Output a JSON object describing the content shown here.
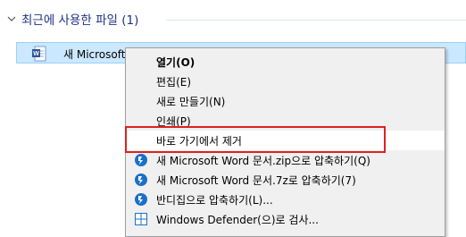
{
  "group": {
    "title": "최근에 사용한 파일 (1)"
  },
  "file": {
    "name": "새 Microsoft Word 문서.docx"
  },
  "menu": {
    "items": [
      {
        "label": "열기(O)",
        "icon": "",
        "bold": true
      },
      {
        "label": "편집(E)",
        "icon": ""
      },
      {
        "label": "새로 만들기(N)",
        "icon": ""
      },
      {
        "label": "인쇄(P)",
        "icon": ""
      },
      {
        "label": "바로 가기에서 제거",
        "icon": "",
        "highlighted": true
      },
      {
        "label": "새 Microsoft Word 문서.zip으로 압축하기(Q)",
        "icon": "bandizip-icon"
      },
      {
        "label": "새 Microsoft Word 문서.7z로 압축하기(7)",
        "icon": "bandizip-icon"
      },
      {
        "label": "반디집으로 압축하기(L)...",
        "icon": "bandizip-icon"
      },
      {
        "label": "Windows Defender(으)로 검사...",
        "icon": "windows-defender-icon"
      }
    ]
  },
  "colors": {
    "accent": "#1e3287",
    "selection": "#cce8ff",
    "highlight_border": "#e02020"
  }
}
